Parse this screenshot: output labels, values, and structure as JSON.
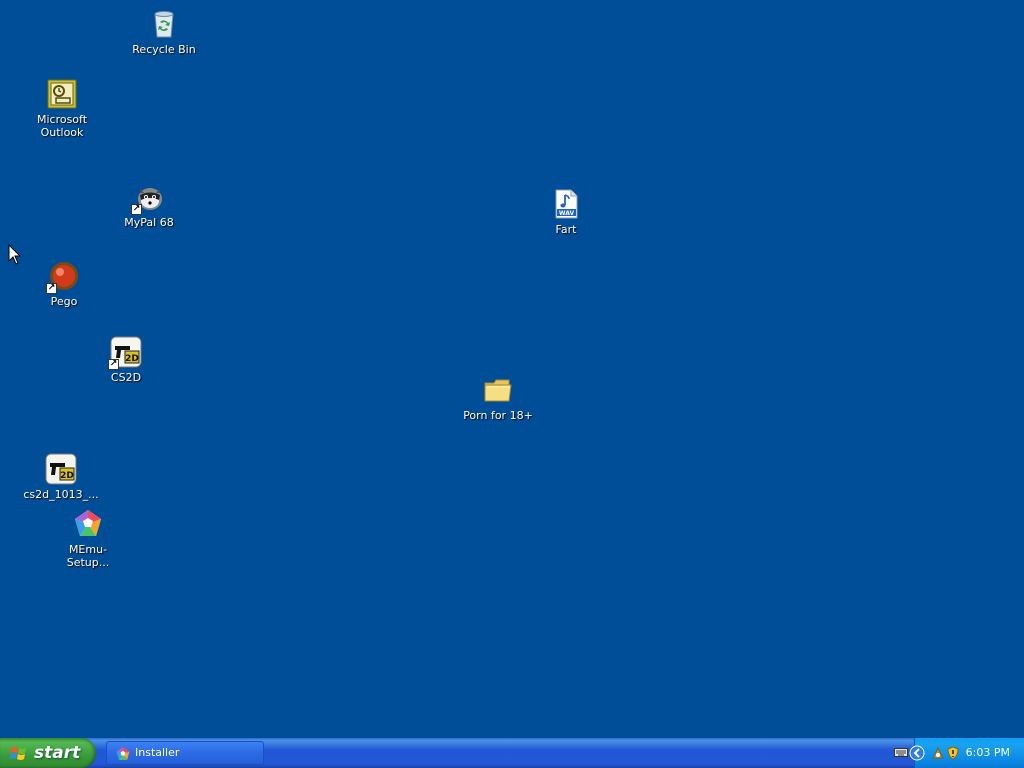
{
  "desktop": {
    "background": "#004e98",
    "icons": {
      "recycle_bin": "Recycle Bin",
      "outlook_line1": "Microsoft",
      "outlook_line2": "Outlook",
      "mypal": "MyPal 68",
      "pego": "Pego",
      "cs2d": "CS2D",
      "cs2d_setup": "cs2d_1013_...",
      "memu_setup": "MEmu-Setup...",
      "fart": "Fart",
      "folder": "Porn for 18+"
    }
  },
  "taskbar": {
    "start_label": "start",
    "tasks": [
      "Installer"
    ],
    "clock": "6:03 PM"
  }
}
